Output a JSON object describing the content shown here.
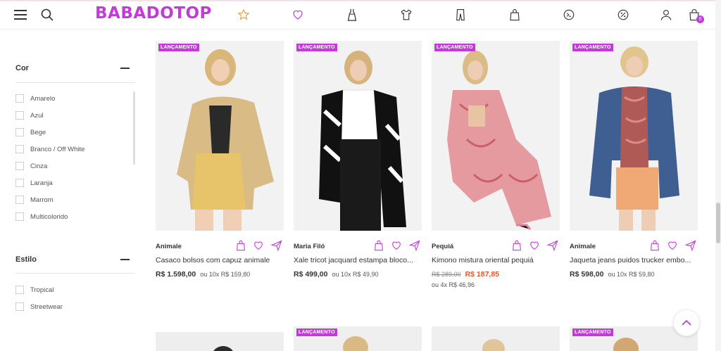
{
  "header": {
    "logo": "BABADOTOP",
    "icons": [
      "menu-icon",
      "search-icon",
      "star-icon",
      "heart-icon",
      "dress-icon",
      "tshirt-icon",
      "pants-icon",
      "bag-icon",
      "brand-icon",
      "discount-icon",
      "user-icon",
      "cart-icon"
    ],
    "cart_count": "0",
    "accent": "#c23bd9",
    "favorites_color": "#e3a64a"
  },
  "sidebar": {
    "color_filter": {
      "title": "Cor",
      "options": [
        "Amarelo",
        "Azul",
        "Bege",
        "Branco  / Off White",
        "Cinza",
        "Laranja",
        "Marrom",
        "Multicolorido"
      ]
    },
    "style_filter": {
      "title": "Estilo",
      "options": [
        "Tropical",
        "Streetwear"
      ]
    }
  },
  "products": [
    {
      "badge": "LANÇAMENTO",
      "brand": "Animale",
      "name": "Casaco bolsos com capuz animale",
      "price": "R$ 1.598,00",
      "installments": "ou 10x R$ 159,80"
    },
    {
      "badge": "LANÇAMENTO",
      "brand": "Maria Filó",
      "name": "Xale tricot jacquard estampa bloco...",
      "price": "R$ 499,00",
      "installments": "ou 10x R$ 49,90"
    },
    {
      "badge": "LANÇAMENTO",
      "brand": "Pequiá",
      "name": "Kimono mistura oriental pequiá",
      "old_price": "R$ 289,00",
      "price": "R$ 187,85",
      "installments": "ou 4x R$ 46,96"
    },
    {
      "badge": "LANÇAMENTO",
      "brand": "Animale",
      "name": "Jaqueta jeans puidos trucker embo...",
      "price": "R$ 598,00",
      "installments": "ou 10x R$ 59,80"
    }
  ],
  "row2_badges": [
    "LANÇAMENTO",
    "LANÇAMENTO"
  ],
  "sale_color": "#e8542a"
}
